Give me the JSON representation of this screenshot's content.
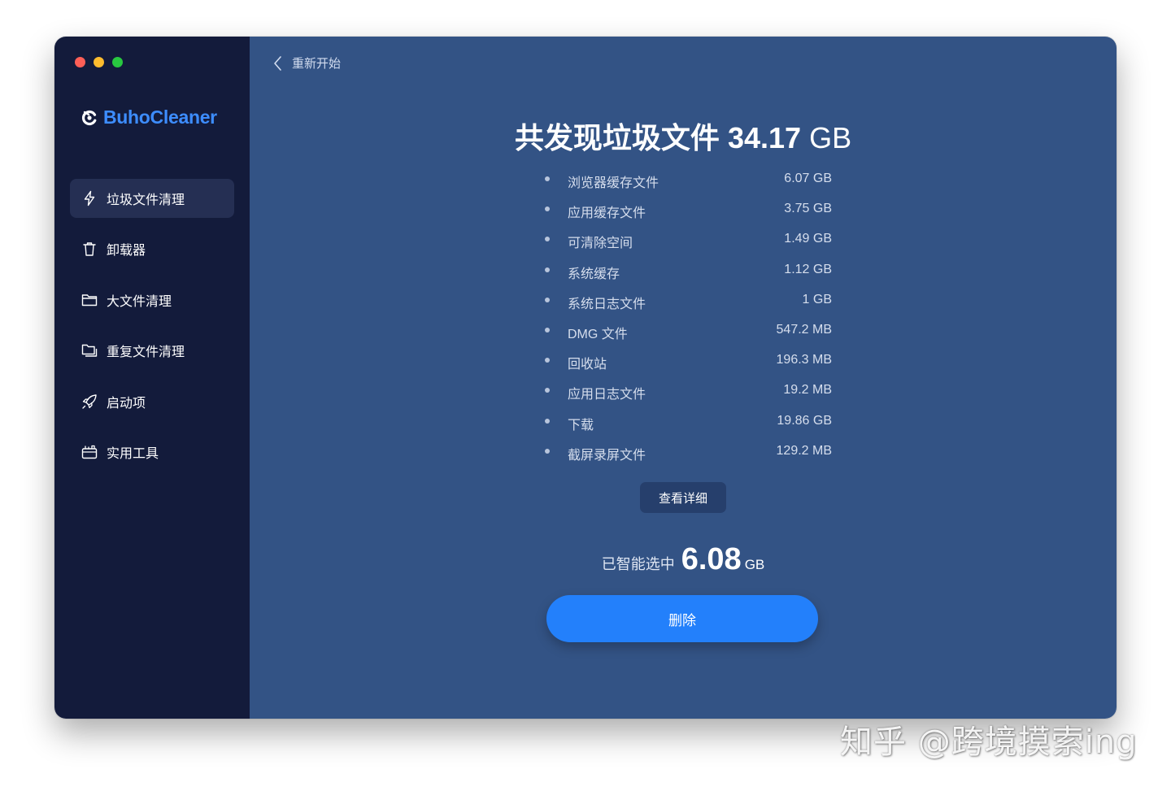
{
  "app": {
    "brand_name": "BuhoCleaner",
    "accent_color": "#3d8dff"
  },
  "sidebar": {
    "items": [
      {
        "label": "垃圾文件清理",
        "icon": "lightning-icon",
        "active": true
      },
      {
        "label": "卸载器",
        "icon": "trash-icon",
        "active": false
      },
      {
        "label": "大文件清理",
        "icon": "folder-icon",
        "active": false
      },
      {
        "label": "重复文件清理",
        "icon": "duplicate-folder-icon",
        "active": false
      },
      {
        "label": "启动项",
        "icon": "rocket-icon",
        "active": false
      },
      {
        "label": "实用工具",
        "icon": "toolbox-icon",
        "active": false
      }
    ]
  },
  "header": {
    "back_label": "重新开始"
  },
  "summary": {
    "title_prefix": "共发现垃圾文件",
    "total_value": "34.17",
    "total_unit": "GB"
  },
  "junk_items": [
    {
      "label": "浏览器缓存文件",
      "size": "6.07 GB"
    },
    {
      "label": "应用缓存文件",
      "size": "3.75 GB"
    },
    {
      "label": "可清除空间",
      "size": "1.49 GB"
    },
    {
      "label": "系统缓存",
      "size": "1.12 GB"
    },
    {
      "label": "系统日志文件",
      "size": "1 GB"
    },
    {
      "label": "DMG 文件",
      "size": "547.2 MB"
    },
    {
      "label": "回收站",
      "size": "196.3 MB"
    },
    {
      "label": "应用日志文件",
      "size": "19.2 MB"
    },
    {
      "label": "下载",
      "size": "19.86 GB"
    },
    {
      "label": "截屏录屏文件",
      "size": "129.2 MB"
    }
  ],
  "actions": {
    "details_label": "查看详细",
    "selected_label": "已智能选中",
    "selected_value": "6.08",
    "selected_unit": "GB",
    "delete_label": "删除",
    "delete_color": "#2380fb"
  },
  "watermark": "知乎 @跨境摸索ing"
}
